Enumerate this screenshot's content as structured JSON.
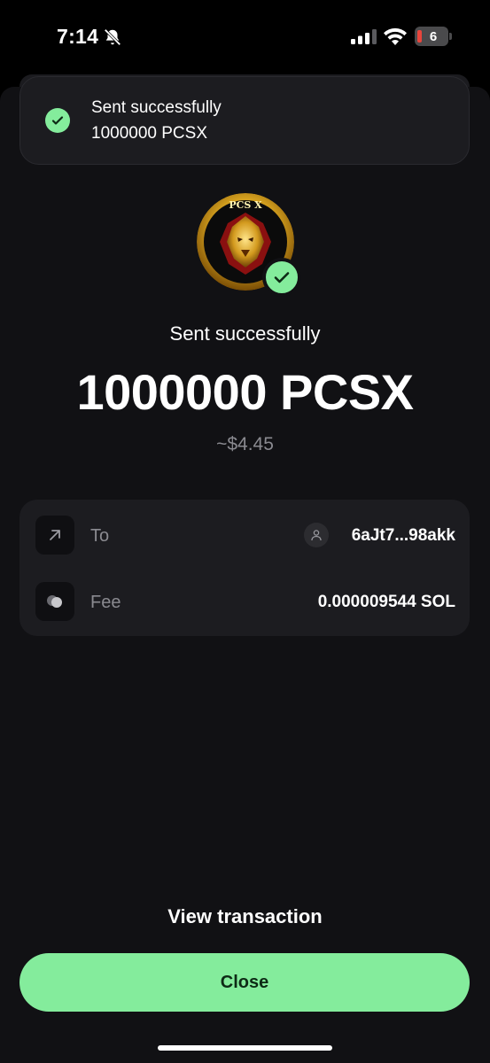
{
  "status_bar": {
    "time": "7:14",
    "battery_level": "6",
    "icons": [
      "bell-slash-icon",
      "signal-icon",
      "wifi-icon",
      "battery-icon"
    ]
  },
  "toast": {
    "title": "Sent successfully",
    "subtitle": "1000000 PCSX",
    "icon": "check-circle-icon"
  },
  "token": {
    "logo_text": "PCS X",
    "icon": "check-badge-icon"
  },
  "result": {
    "label": "Sent successfully",
    "amount": "1000000 PCSX",
    "fiat": "~$4.45"
  },
  "details": {
    "to_label": "To",
    "to_value": "6aJt7...98akk",
    "fee_label": "Fee",
    "fee_value": "0.000009544 SOL"
  },
  "actions": {
    "view_transaction": "View transaction",
    "close": "Close"
  },
  "colors": {
    "accent": "#84ec9c",
    "background": "#111114",
    "card": "#1c1c20",
    "muted_text": "#8a8a90"
  }
}
